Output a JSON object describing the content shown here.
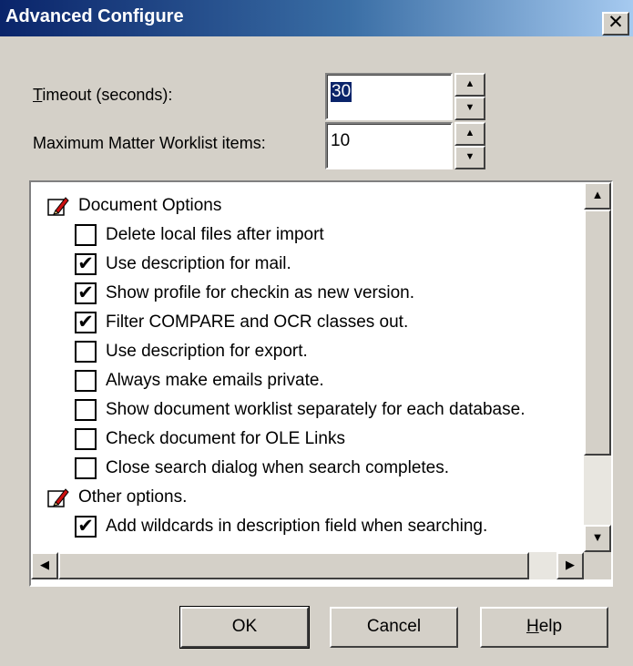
{
  "window": {
    "title": "Advanced Configure",
    "close_glyph": "✕"
  },
  "timeout": {
    "label_accel": "T",
    "label_rest": "imeout (seconds):",
    "value": "30"
  },
  "worklist": {
    "label": "Maximum Matter Worklist items:",
    "value": "10"
  },
  "options": {
    "groups": [
      {
        "label": "Document Options",
        "icon": "pencil-icon",
        "items": [
          {
            "label": "Delete local files after import",
            "checked": false
          },
          {
            "label": "Use description for mail.",
            "checked": true
          },
          {
            "label": "Show profile for checkin as new version.",
            "checked": true
          },
          {
            "label": "Filter COMPARE and OCR classes out.",
            "checked": true
          },
          {
            "label": "Use description for export.",
            "checked": false
          },
          {
            "label": "Always make emails private.",
            "checked": false
          },
          {
            "label": "Show document worklist separately for each database.",
            "checked": false
          },
          {
            "label": "Check document for OLE Links",
            "checked": false
          },
          {
            "label": "Close search dialog when search completes.",
            "checked": false
          }
        ]
      },
      {
        "label": "Other options.",
        "icon": "pencil-icon",
        "items": [
          {
            "label": "Add wildcards in description field when searching.",
            "checked": true
          }
        ]
      }
    ]
  },
  "buttons": {
    "ok": "OK",
    "cancel": "Cancel",
    "help_accel": "H",
    "help_rest": "elp"
  },
  "colors": {
    "title_start": "#0a246a",
    "title_end": "#a6caf0",
    "face": "#d4d0c8",
    "selection": "#0a246a"
  }
}
